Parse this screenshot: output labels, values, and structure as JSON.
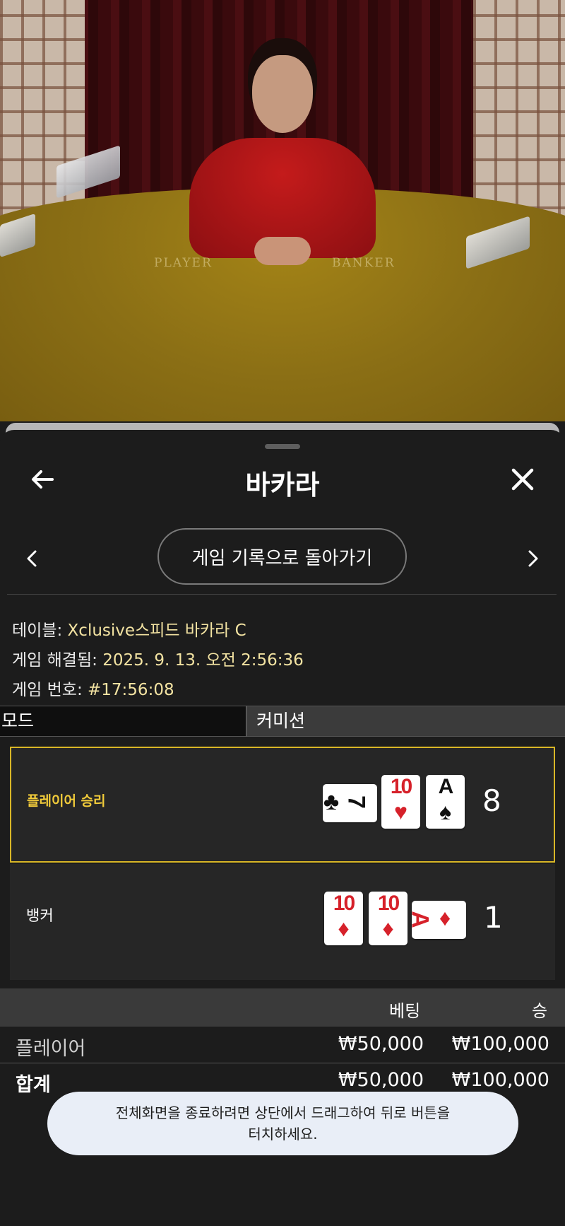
{
  "video": {
    "felt_left": "PLAYER",
    "felt_right": "BANKER"
  },
  "header": {
    "title": "바카라"
  },
  "nav": {
    "history_button": "게임 기록으로 돌아가기"
  },
  "info": {
    "table_label": "테이블:",
    "table_value": "Xclusive스피드 바카라 C",
    "resolved_label": "게임 해결됨:",
    "resolved_value": "2025. 9. 13. 오전 2:56:36",
    "number_label": "게임 번호:",
    "number_value": "#17:56:08"
  },
  "tabs": {
    "mode": "모드",
    "commission": "커미션"
  },
  "results": {
    "player": {
      "label": "플레이어 승리",
      "score": "8",
      "cards": [
        {
          "rank": "7",
          "suit": "♣",
          "color": "black",
          "rotated": true
        },
        {
          "rank": "10",
          "suit": "♥",
          "color": "red",
          "rotated": false
        },
        {
          "rank": "A",
          "suit": "♠",
          "color": "black",
          "rotated": false
        }
      ]
    },
    "banker": {
      "label": "뱅커",
      "score": "1",
      "cards": [
        {
          "rank": "10",
          "suit": "♦",
          "color": "red",
          "rotated": false
        },
        {
          "rank": "10",
          "suit": "♦",
          "color": "red",
          "rotated": false
        },
        {
          "rank": "A",
          "suit": "♦",
          "color": "red",
          "rotated": true
        }
      ]
    }
  },
  "bets": {
    "col_bet": "베팅",
    "col_win": "승",
    "player_label": "플레이어",
    "player_bet": "₩50,000",
    "player_win": "₩100,000",
    "total_label": "합계",
    "total_bet": "₩50,000",
    "total_win": "₩100,000"
  },
  "toast": {
    "line1": "전체화면을 종료하려면 상단에서 드래그하여 뒤로 버튼을",
    "line2": "터치하세요."
  },
  "colors": {
    "accent_gold": "#d8b626",
    "info_value": "#f3e3a2",
    "card_red": "#d6212a"
  }
}
